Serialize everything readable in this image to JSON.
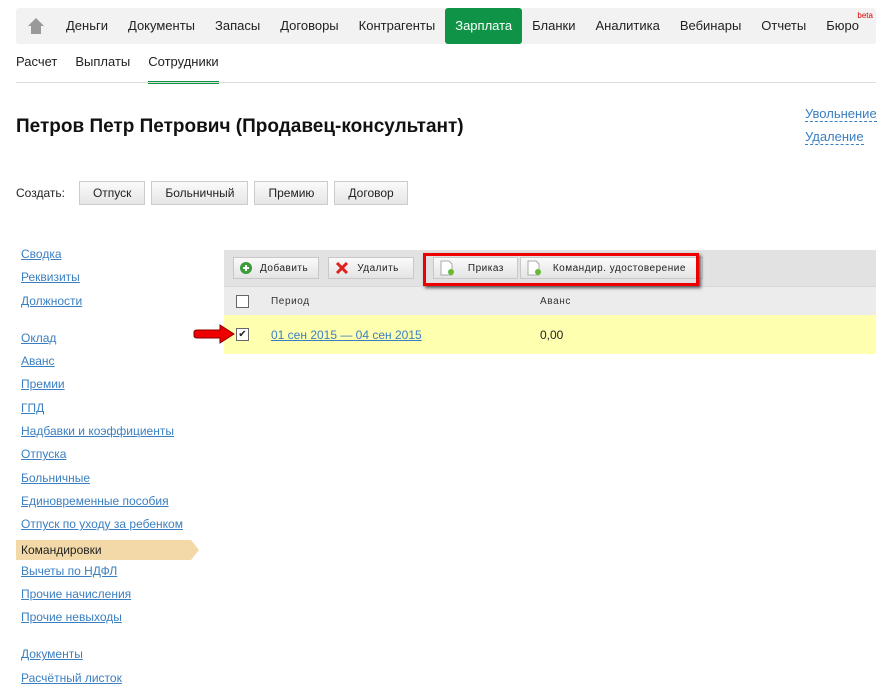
{
  "nav": {
    "items": [
      "Деньги",
      "Документы",
      "Запасы",
      "Договоры",
      "Контрагенты",
      "Зарплата",
      "Бланки",
      "Аналитика",
      "Вебинары",
      "Отчеты",
      "Бюро"
    ],
    "active": "Зарплата",
    "beta": "beta"
  },
  "subtabs": [
    "Расчет",
    "Выплаты",
    "Сотрудники"
  ],
  "title": "Петров Петр Петрович (Продавец-консультант)",
  "right_links": {
    "dismiss": "Увольнение",
    "delete": "Удаление"
  },
  "create": {
    "label": "Создать:",
    "buttons": [
      "Отпуск",
      "Больничный",
      "Премию",
      "Договор"
    ]
  },
  "sidebar": {
    "group1": [
      "Сводка",
      "Реквизиты",
      "Должности"
    ],
    "group2": [
      "Оклад",
      "Аванс",
      "Премии",
      "ГПД",
      "Надбавки и коэффициенты",
      "Отпуска",
      "Больничные",
      "Единовременные пособия",
      "Отпуск по уходу за ребенком",
      "Командировки",
      "Вычеты по НДФЛ",
      "Прочие начисления",
      "Прочие невыходы"
    ],
    "group3": [
      "Документы",
      "Расчётный листок"
    ],
    "active": "Командировки"
  },
  "toolbar": {
    "add": "Добавить",
    "delete": "Удалить",
    "order": "Приказ",
    "certificate": "Командир. удостоверение"
  },
  "table": {
    "columns": [
      "Период",
      "Аванс"
    ],
    "rows": [
      {
        "period": "01 сен 2015 — 04 сен 2015",
        "advance": "0,00",
        "checked": true
      }
    ]
  },
  "colors": {
    "accent": "#0f9447",
    "highlight": "#ff0000",
    "row": "#ffffb0"
  }
}
